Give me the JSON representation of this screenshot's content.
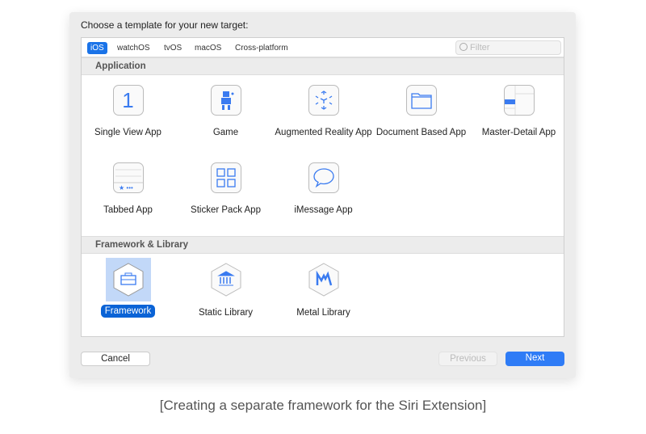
{
  "dialog": {
    "title": "Choose a template for your new target:"
  },
  "tabs": [
    "iOS",
    "watchOS",
    "tvOS",
    "macOS",
    "Cross-platform"
  ],
  "filter": {
    "placeholder": "Filter"
  },
  "sections": [
    {
      "title": "Application",
      "items": [
        "Single View App",
        "Game",
        "Augmented Reality App",
        "Document Based App",
        "Master-Detail App",
        "Tabbed App",
        "Sticker Pack App",
        "iMessage App"
      ]
    },
    {
      "title": "Framework & Library",
      "items": [
        "Framework",
        "Static Library",
        "Metal Library"
      ],
      "selected": "Framework"
    }
  ],
  "icons": {
    "single_view": "1"
  },
  "buttons": {
    "cancel": "Cancel",
    "previous": "Previous",
    "next": "Next"
  },
  "caption": "[Creating a separate framework for the Siri Extension]",
  "colors": {
    "accent": "#2f7cf6",
    "selection": "#0a63d6"
  }
}
